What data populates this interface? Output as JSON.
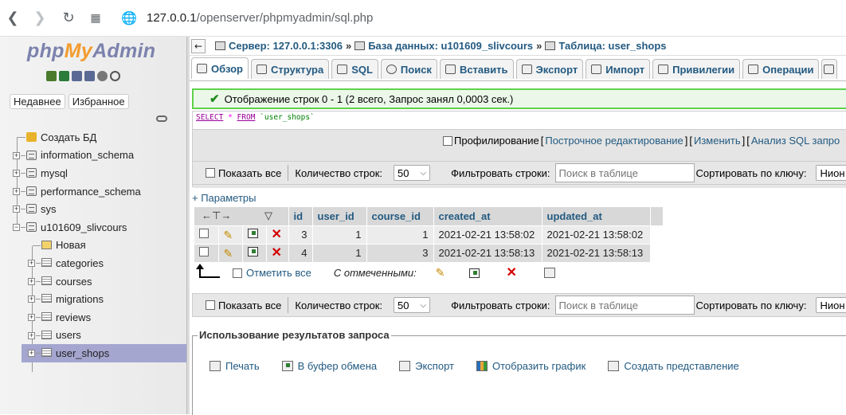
{
  "browser": {
    "url_host": "127.0.0.1",
    "url_path": "/openserver/phpmyadmin/sql.php"
  },
  "nav": {
    "logo": {
      "php": "php",
      "my": "My",
      "admin": "Admin"
    },
    "recent_label": "Недавнее",
    "favorites_label": "Избранное",
    "tree": [
      {
        "label": "Создать БД",
        "type": "new-db",
        "level": 0
      },
      {
        "label": "information_schema",
        "type": "db",
        "level": 0
      },
      {
        "label": "mysql",
        "type": "db",
        "level": 0
      },
      {
        "label": "performance_schema",
        "type": "db",
        "level": 0
      },
      {
        "label": "sys",
        "type": "db",
        "level": 0
      },
      {
        "label": "u101609_slivcours",
        "type": "db",
        "level": 0,
        "expanded": true
      },
      {
        "label": "Новая",
        "type": "new-table",
        "level": 1
      },
      {
        "label": "categories",
        "type": "table",
        "level": 1
      },
      {
        "label": "courses",
        "type": "table",
        "level": 1
      },
      {
        "label": "migrations",
        "type": "table",
        "level": 1
      },
      {
        "label": "reviews",
        "type": "table",
        "level": 1
      },
      {
        "label": "users",
        "type": "table",
        "level": 1
      },
      {
        "label": "user_shops",
        "type": "table",
        "level": 1,
        "selected": true
      }
    ]
  },
  "breadcrumb": {
    "server": "Сервер: 127.0.0.1:3306",
    "database": "База данных: u101609_slivcours",
    "table": "Таблица: user_shops",
    "separator": "»"
  },
  "tabs": [
    {
      "label": "Обзор",
      "active": true
    },
    {
      "label": "Структура"
    },
    {
      "label": "SQL"
    },
    {
      "label": "Поиск"
    },
    {
      "label": "Вставить"
    },
    {
      "label": "Экспорт"
    },
    {
      "label": "Импорт"
    },
    {
      "label": "Привилегии"
    },
    {
      "label": "Операции"
    }
  ],
  "message": "Отображение строк 0 - 1 (2 всего, Запрос занял 0,0003 сек.)",
  "sql": {
    "select": "SELECT",
    "star": "*",
    "from": "FROM",
    "table": "`user_shops`"
  },
  "profiling": {
    "label": "Профилирование",
    "open_bracket": "[",
    "close_bracket": "]",
    "inline_edit": "Построчное редактирование",
    "edit": "Изменить",
    "analyze": "Анализ SQL запро"
  },
  "navbar": {
    "show_all": "Показать все",
    "rows_label": "Количество строк:",
    "rows_value": "50",
    "filter_label": "Фильтровать строки:",
    "filter_placeholder": "Поиск в таблице",
    "sort_label": "Сортировать по ключу:",
    "sort_value": "Нион"
  },
  "params_link": "+ Параметры",
  "table": {
    "columns": [
      "id",
      "user_id",
      "course_id",
      "created_at",
      "updated_at"
    ],
    "rows": [
      {
        "id": "3",
        "user_id": "1",
        "course_id": "1",
        "created_at": "2021-02-21 13:58:02",
        "updated_at": "2021-02-21 13:58:02"
      },
      {
        "id": "4",
        "user_id": "1",
        "course_id": "3",
        "created_at": "2021-02-21 13:58:13",
        "updated_at": "2021-02-21 13:58:13"
      }
    ]
  },
  "with_selected": {
    "check_all": "Отметить все",
    "label": "С отмеченными:"
  },
  "query_results": {
    "legend": "Использование результатов запроса",
    "print": "Печать",
    "clipboard": "В буфер обмена",
    "export": "Экспорт",
    "chart": "Отобразить график",
    "create_view": "Создать представление"
  }
}
